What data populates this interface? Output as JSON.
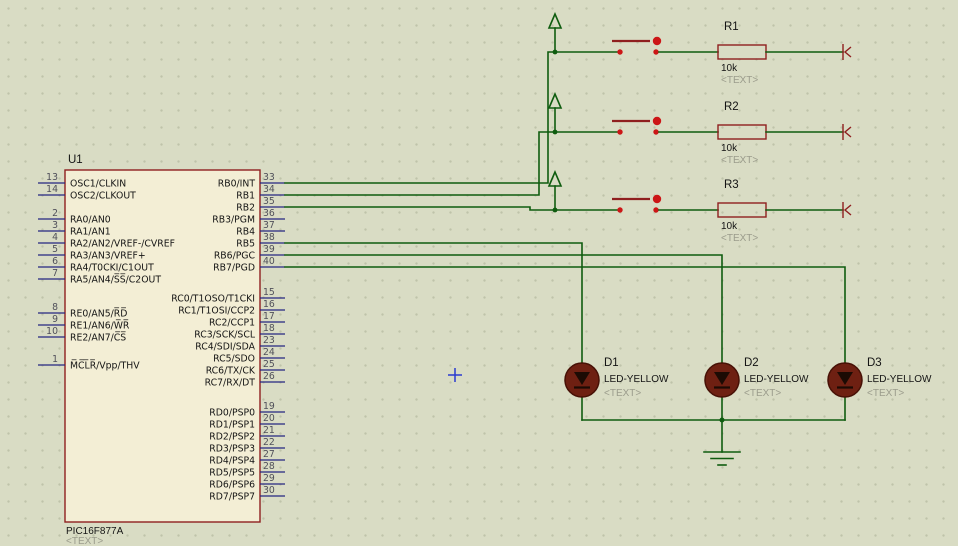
{
  "colors": {
    "background": "#d9dcc4",
    "grid_dot": "#bfc3aa",
    "wire": "#0f5c0f",
    "component_outline": "#8f1f1f",
    "pin": "#262680",
    "chip_fill": "#f3eed5",
    "text": "#141414",
    "muted_text": "#9b9c8c",
    "pin_number": "#50505a",
    "red_indicator": "#cc1616",
    "led_body": "#6e2012",
    "origin_marker": "#2a3bd0"
  },
  "chip": {
    "ref": "U1",
    "value": "PIC16F877A",
    "text_placeholder": "<TEXT>",
    "left_pins": [
      {
        "num": "13",
        "name": "OSC1/CLKIN"
      },
      {
        "num": "14",
        "name": "OSC2/CLKOUT"
      },
      {
        "num": "2",
        "name": "RA0/AN0"
      },
      {
        "num": "3",
        "name": "RA1/AN1"
      },
      {
        "num": "4",
        "name": "RA2/AN2/VREF-/CVREF"
      },
      {
        "num": "5",
        "name": "RA3/AN3/VREF+"
      },
      {
        "num": "6",
        "name": "RA4/T0CKI/C1OUT"
      },
      {
        "num": "7",
        "name": "RA5/AN4/S̅S̅/C2OUT"
      },
      {
        "num": "8",
        "name": "RE0/AN5/R̅D̅"
      },
      {
        "num": "9",
        "name": "RE1/AN6/W̅R̅"
      },
      {
        "num": "10",
        "name": "RE2/AN7/C̅S̅"
      },
      {
        "num": "1",
        "name": "M̅C̅L̅R̅/Vpp/THV"
      }
    ],
    "right_pins": [
      {
        "num": "33",
        "name": "RB0/INT"
      },
      {
        "num": "34",
        "name": "RB1"
      },
      {
        "num": "35",
        "name": "RB2"
      },
      {
        "num": "36",
        "name": "RB3/PGM"
      },
      {
        "num": "37",
        "name": "RB4"
      },
      {
        "num": "38",
        "name": "RB5"
      },
      {
        "num": "39",
        "name": "RB6/PGC"
      },
      {
        "num": "40",
        "name": "RB7/PGD"
      },
      {
        "num": "15",
        "name": "RC0/T1OSO/T1CKI"
      },
      {
        "num": "16",
        "name": "RC1/T1OSI/CCP2"
      },
      {
        "num": "17",
        "name": "RC2/CCP1"
      },
      {
        "num": "18",
        "name": "RC3/SCK/SCL"
      },
      {
        "num": "23",
        "name": "RC4/SDI/SDA"
      },
      {
        "num": "24",
        "name": "RC5/SDO"
      },
      {
        "num": "25",
        "name": "RC6/TX/CK"
      },
      {
        "num": "26",
        "name": "RC7/RX/DT"
      },
      {
        "num": "19",
        "name": "RD0/PSP0"
      },
      {
        "num": "20",
        "name": "RD1/PSP1"
      },
      {
        "num": "21",
        "name": "RD2/PSP2"
      },
      {
        "num": "22",
        "name": "RD3/PSP3"
      },
      {
        "num": "27",
        "name": "RD4/PSP4"
      },
      {
        "num": "28",
        "name": "RD5/PSP5"
      },
      {
        "num": "29",
        "name": "RD6/PSP6"
      },
      {
        "num": "30",
        "name": "RD7/PSP7"
      }
    ]
  },
  "switch_rows": [
    {
      "resistor_ref": "R1",
      "resistor_value": "10k",
      "text_placeholder": "<TEXT>"
    },
    {
      "resistor_ref": "R2",
      "resistor_value": "10k",
      "text_placeholder": "<TEXT>"
    },
    {
      "resistor_ref": "R3",
      "resistor_value": "10k",
      "text_placeholder": "<TEXT>"
    }
  ],
  "leds": [
    {
      "ref": "D1",
      "value": "LED-YELLOW",
      "text_placeholder": "<TEXT>"
    },
    {
      "ref": "D2",
      "value": "LED-YELLOW",
      "text_placeholder": "<TEXT>"
    },
    {
      "ref": "D3",
      "value": "LED-YELLOW",
      "text_placeholder": "<TEXT>"
    }
  ]
}
